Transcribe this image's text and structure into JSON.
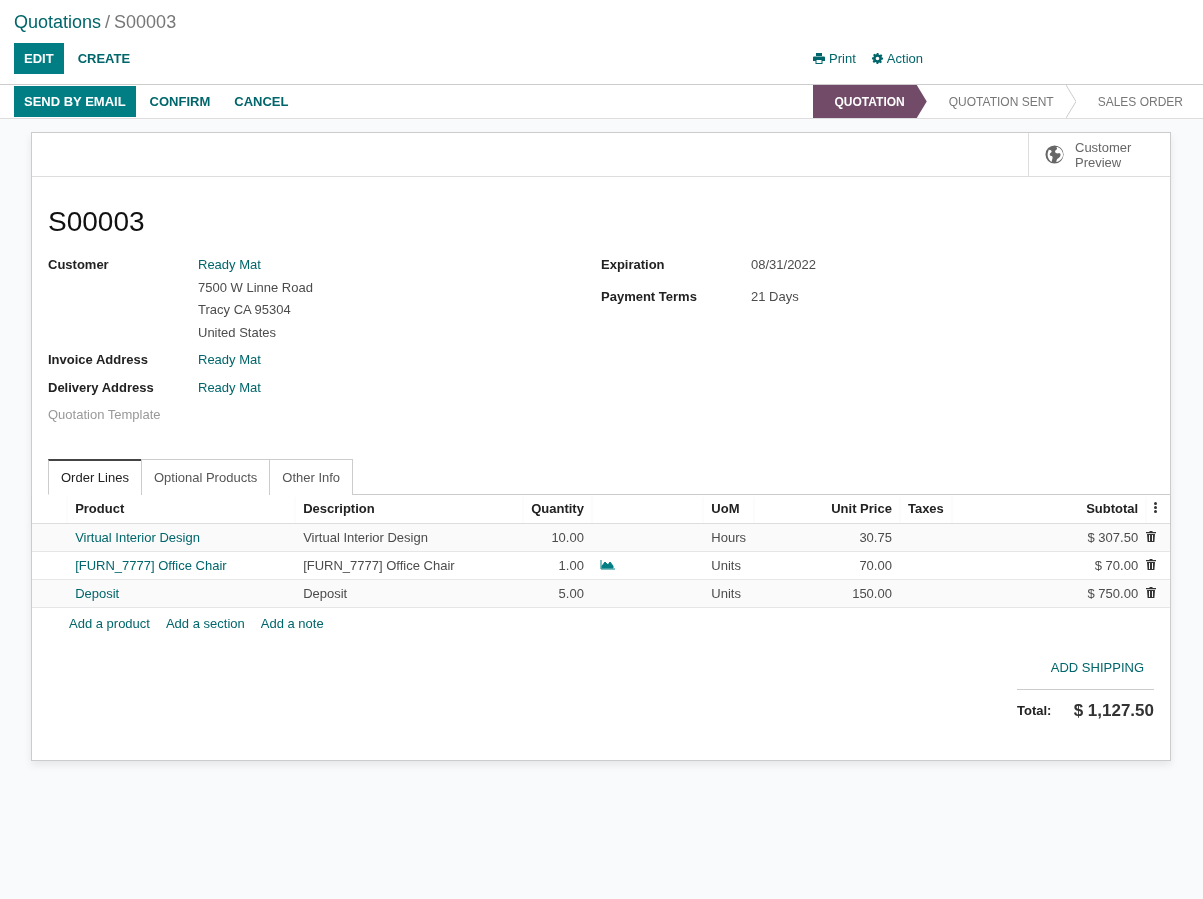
{
  "breadcrumb": [
    {
      "label": "Quotations",
      "kind": "link"
    },
    {
      "label": "/",
      "kind": "separator"
    },
    {
      "label": "S00003",
      "kind": "current"
    }
  ],
  "control_buttons": [
    {
      "label": "EDIT",
      "primary": true
    },
    {
      "label": "CREATE",
      "primary": false
    }
  ],
  "actions": [
    {
      "label": "Print",
      "kind": "print"
    },
    {
      "label": "Action",
      "kind": "gear"
    }
  ],
  "status_buttons": [
    {
      "label": "SEND BY EMAIL",
      "primary": true
    },
    {
      "label": "CONFIRM",
      "primary": false
    },
    {
      "label": "CANCEL",
      "primary": false
    }
  ],
  "stages": [
    {
      "label": "QUOTATION",
      "selected": true
    },
    {
      "label": "QUOTATION SENT",
      "selected": false
    },
    {
      "label": "SALES ORDER",
      "selected": false
    }
  ],
  "smart_button": {
    "label": "Customer Preview"
  },
  "title": "S00003",
  "left_fields": [
    {
      "label": "Customer",
      "muted": false,
      "link": "Ready Mat",
      "address": [
        "7500 W Linne Road",
        "Tracy CA 95304",
        "United States"
      ]
    },
    {
      "label": "Invoice Address",
      "muted": false,
      "link": "Ready Mat"
    },
    {
      "label": "Delivery Address",
      "muted": false,
      "link": "Ready Mat"
    },
    {
      "label": "Quotation Template",
      "muted": true
    }
  ],
  "right_fields": [
    {
      "label": "Expiration",
      "value": "08/31/2022"
    },
    {
      "label": "Payment Terms",
      "value": "21 Days"
    }
  ],
  "tabs": [
    {
      "label": "Order Lines",
      "selected": true
    },
    {
      "label": "Optional Products",
      "selected": false
    },
    {
      "label": "Other Info",
      "selected": false
    }
  ],
  "table": {
    "columns": [
      {
        "label": "Product",
        "kind": "text"
      },
      {
        "label": "Description",
        "kind": "text"
      },
      {
        "label": "Quantity",
        "kind": "number"
      },
      {
        "label": "UoM",
        "kind": "text"
      },
      {
        "label": "Unit Price",
        "kind": "number"
      },
      {
        "label": "Taxes",
        "kind": "text"
      },
      {
        "label": "Subtotal",
        "kind": "number"
      }
    ],
    "rows": [
      {
        "product": "Virtual Interior Design",
        "description": "Virtual Interior Design",
        "quantity": "10.00",
        "forecast": false,
        "uom": "Hours",
        "unit_price": "30.75",
        "subtotal": "$ 307.50"
      },
      {
        "product": "[FURN_7777] Office Chair",
        "description": "[FURN_7777] Office Chair",
        "quantity": "1.00",
        "forecast": true,
        "uom": "Units",
        "unit_price": "70.00",
        "subtotal": "$ 70.00"
      },
      {
        "product": "Deposit",
        "description": "Deposit",
        "quantity": "5.00",
        "forecast": false,
        "uom": "Units",
        "unit_price": "150.00",
        "subtotal": "$ 750.00"
      }
    ]
  },
  "add_links": [
    "Add a product",
    "Add a section",
    "Add a note"
  ],
  "add_shipping": "ADD SHIPPING",
  "total": {
    "label": "Total:",
    "amount": "$ 1,127.50"
  }
}
